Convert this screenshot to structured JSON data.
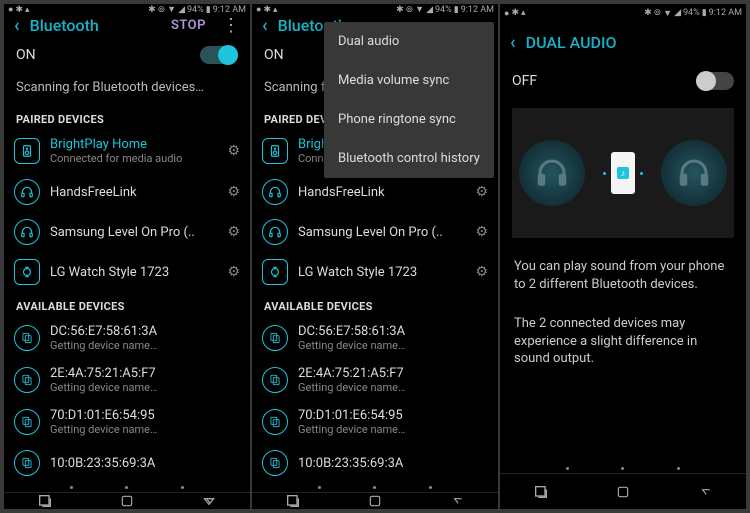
{
  "status": {
    "battery": "94%",
    "time": "9:12 AM"
  },
  "screen1": {
    "title": "Bluetooth",
    "action": "STOP",
    "toggle_label": "ON",
    "scan_text": "Scanning for Bluetooth devices…",
    "paired_header": "PAIRED DEVICES",
    "available_header": "AVAILABLE DEVICES",
    "paired": [
      {
        "name": "BrightPlay Home",
        "sub": "Connected for media audio",
        "active": true,
        "icon": "speaker"
      },
      {
        "name": "HandsFreeLink",
        "sub": "",
        "active": false,
        "icon": "headset"
      },
      {
        "name": "Samsung Level On Pro (..",
        "sub": "",
        "active": false,
        "icon": "headset"
      },
      {
        "name": "LG Watch Style 1723",
        "sub": "",
        "active": false,
        "icon": "watch"
      }
    ],
    "available": [
      {
        "name": "DC:56:E7:58:61:3A",
        "sub": "Getting device name…"
      },
      {
        "name": "2E:4A:75:21:A5:F7",
        "sub": "Getting device name…"
      },
      {
        "name": "70:D1:01:E6:54:95",
        "sub": "Getting device name…"
      },
      {
        "name": "10:0B:23:35:69:3A",
        "sub": "Getting device name…"
      }
    ]
  },
  "screen2_menu": [
    "Dual audio",
    "Media volume sync",
    "Phone ringtone sync",
    "Bluetooth control history"
  ],
  "screen3": {
    "title": "DUAL AUDIO",
    "toggle_label": "OFF",
    "desc1": "You can play sound from your phone to 2 different Bluetooth devices.",
    "desc2": "The 2 connected devices may experience a slight difference in sound output."
  }
}
